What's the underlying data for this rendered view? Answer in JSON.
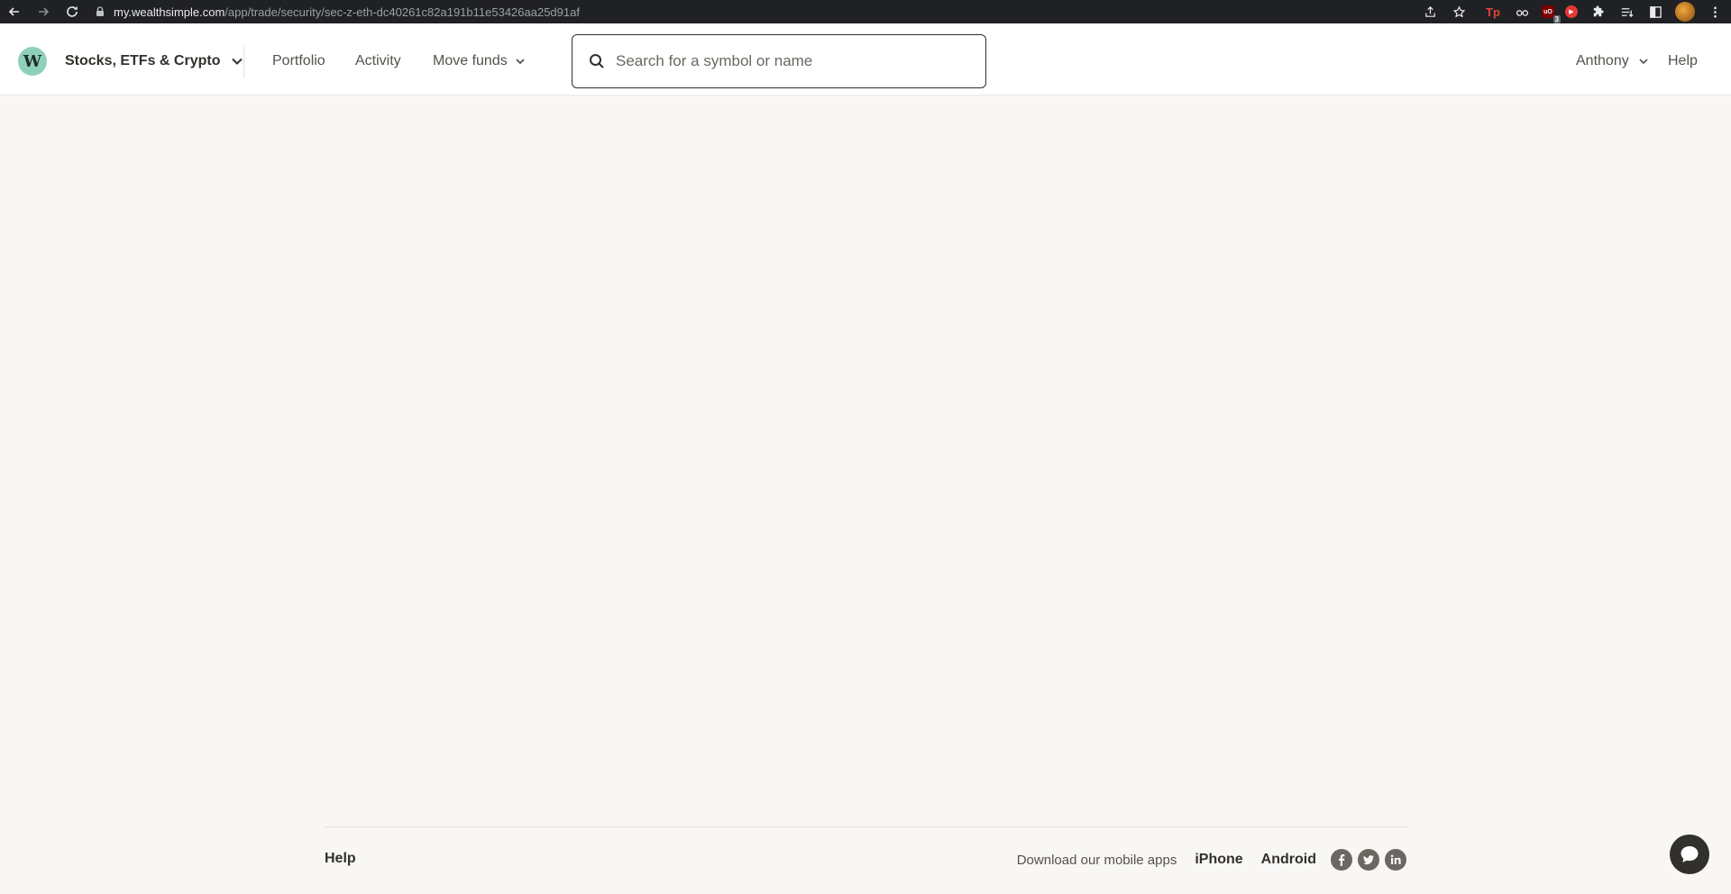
{
  "browser": {
    "url_domain": "my.wealthsimple.com",
    "url_path": "/app/trade/security/sec-z-eth-dc40261c82a191b11e53426aa25d91af",
    "extensions": [
      "share-icon",
      "bookmark-star-icon",
      "tp-extension",
      "glasses-extension",
      "ublock-extension",
      "youtube-extension",
      "puzzle-icon",
      "reading-list-icon",
      "sidepanel-icon",
      "profile-avatar",
      "menu-icon"
    ],
    "ublock_badge": "3",
    "tp_label": "Tp"
  },
  "header": {
    "logo_letter": "W",
    "product_switch_label": "Stocks, ETFs & Crypto",
    "nav": {
      "portfolio": "Portfolio",
      "activity": "Activity",
      "move_funds": "Move funds"
    },
    "search_placeholder": "Search for a symbol or name",
    "user_name": "Anthony",
    "help": "Help"
  },
  "footer": {
    "help": "Help",
    "download_text": "Download our mobile apps",
    "iphone": "iPhone",
    "android": "Android",
    "social": [
      "facebook-icon",
      "twitter-icon",
      "linkedin-icon"
    ]
  },
  "colors": {
    "background": "#f8f7f5",
    "logo_bg": "#8fd0bb",
    "text_dark": "#32302c",
    "text_muted": "#55524c",
    "chrome_bg": "#202124"
  }
}
